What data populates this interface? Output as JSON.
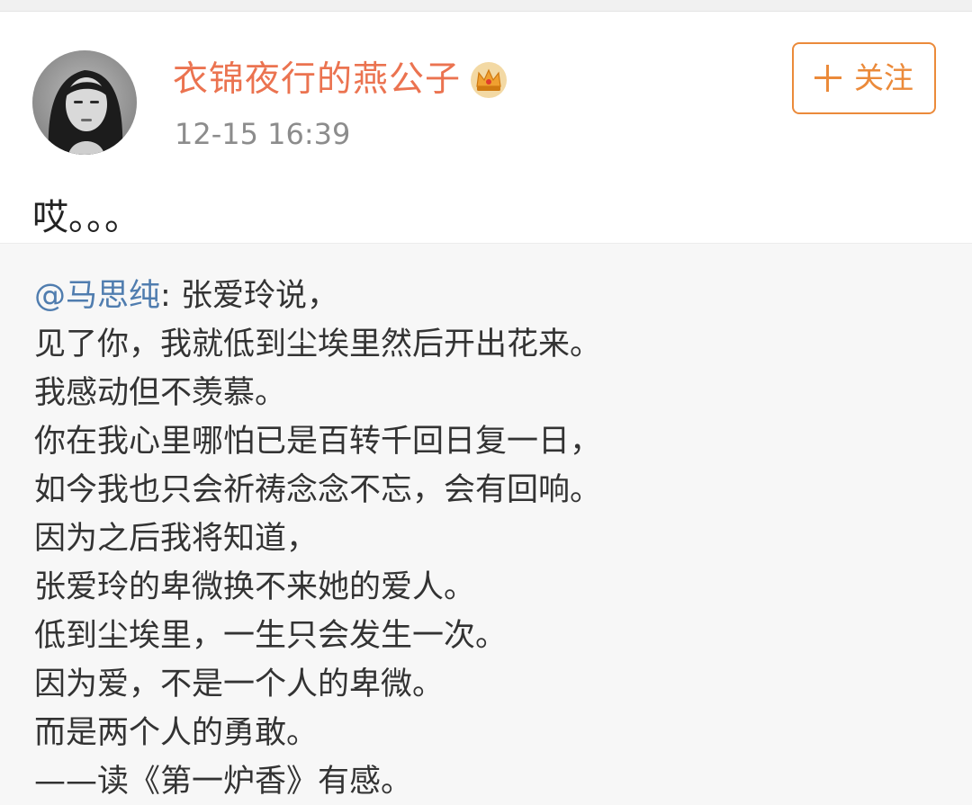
{
  "post": {
    "username": "衣锦夜行的燕公子",
    "timestamp": "12-15 16:39",
    "follow_label": "关注",
    "text": "哎。。。",
    "badge_icon": "crown-vip-icon"
  },
  "repost": {
    "author": "@马思纯",
    "separator": ": ",
    "lines": [
      "张爱玲说，",
      "见了你，我就低到尘埃里然后开出花来。",
      "我感动但不羡慕。",
      "你在我心里哪怕已是百转千回日复一日，",
      "如今我也只会祈祷念念不忘，会有回响。",
      "因为之后我将知道，",
      "张爱玲的卑微换不来她的爱人。",
      "低到尘埃里，一生只会发生一次。",
      "因为爱，不是一个人的卑微。",
      "而是两个人的勇敢。",
      "——读《第一炉香》有感。"
    ]
  },
  "colors": {
    "username": "#eb7350",
    "follow_accent": "#eb8a3a",
    "mention": "#507daf",
    "timestamp": "#8c8c8c",
    "repost_bg": "#f7f7f7"
  }
}
